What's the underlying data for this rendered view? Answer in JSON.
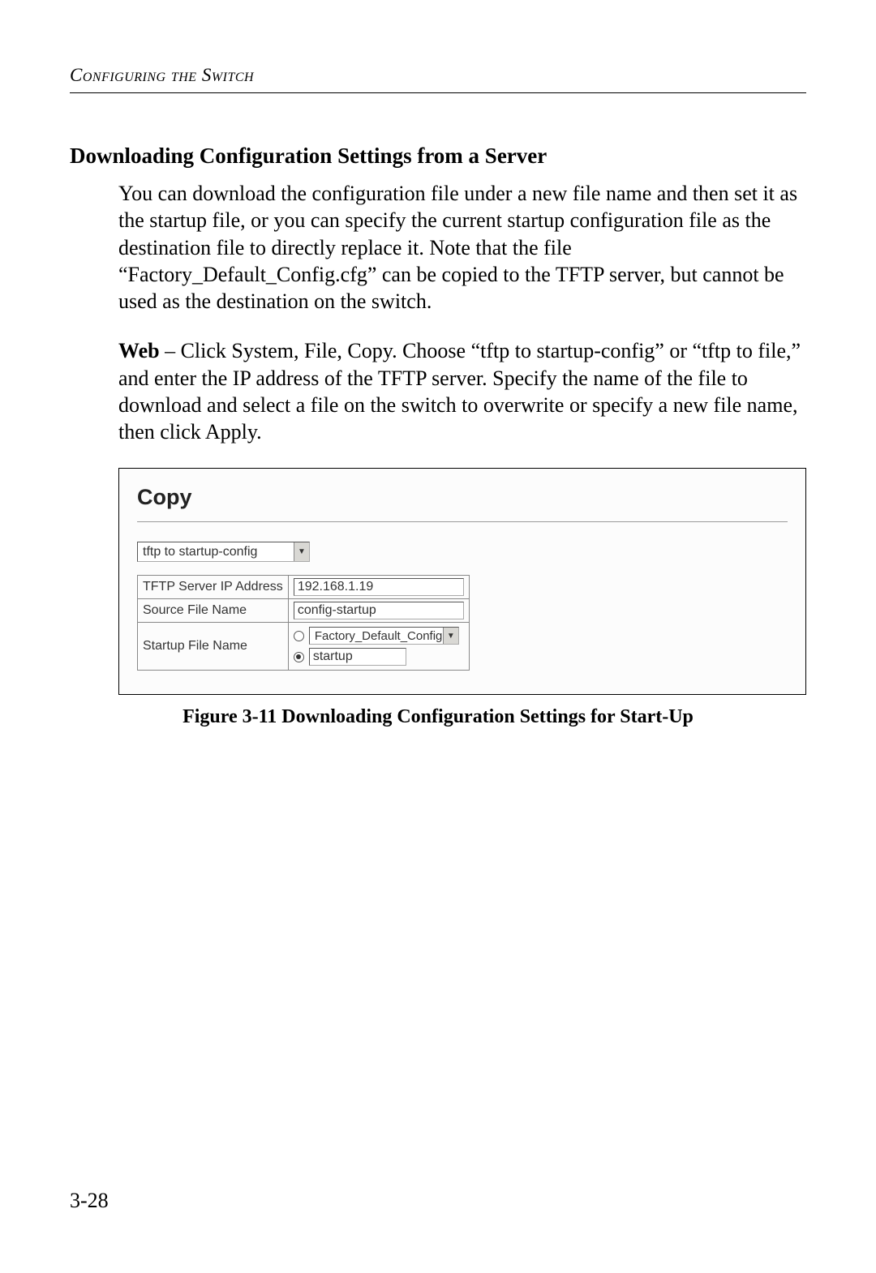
{
  "running_header": "Configuring the Switch",
  "section_heading": "Downloading Configuration Settings from a Server",
  "para1": "You can download the configuration file under a new file name and then set it as the startup file, or you can specify the current startup configuration file as the destination file to directly replace it. Note that the file “Factory_Default_Config.cfg” can be copied to the TFTP server, but cannot be used as the destination on the switch.",
  "para2_bold": "Web",
  "para2_rest": " – Click System, File, Copy. Choose “tftp to startup-config” or “tftp to file,” and enter the IP address of the TFTP server. Specify the name of the file to download and select a file on the switch to overwrite or specify a new file name, then click Apply.",
  "figure": {
    "panel_title": "Copy",
    "mode_select": "tftp to startup-config",
    "rows": {
      "ip_label": "TFTP Server IP Address",
      "ip_value": "192.168.1.19",
      "source_label": "Source File Name",
      "source_value": "config-startup",
      "startup_label": "Startup File Name",
      "startup_option_file": "Factory_Default_Config.cfg",
      "startup_option_text": "startup"
    },
    "caption": "Figure 3-11  Downloading Configuration Settings for Start-Up"
  },
  "page_number": "3-28"
}
